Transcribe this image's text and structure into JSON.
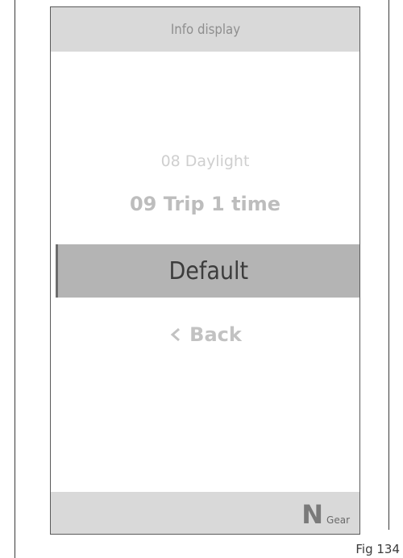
{
  "header": {
    "title": "Info display"
  },
  "menu": {
    "items": [
      {
        "label": "08 Daylight"
      },
      {
        "label": "09 Trip 1 time"
      }
    ],
    "selected_label": "Default",
    "back_label": "Back",
    "back_icon": "chevron-left-icon"
  },
  "footer": {
    "gear_value": "N",
    "gear_label": "Gear"
  },
  "figure": {
    "label": "Fig 134"
  },
  "colors": {
    "bar_background": "#d9d9d9",
    "selected_background": "#b4b4b4",
    "faded_text": "#c2c2c2",
    "selected_text": "#3c3c3c"
  }
}
